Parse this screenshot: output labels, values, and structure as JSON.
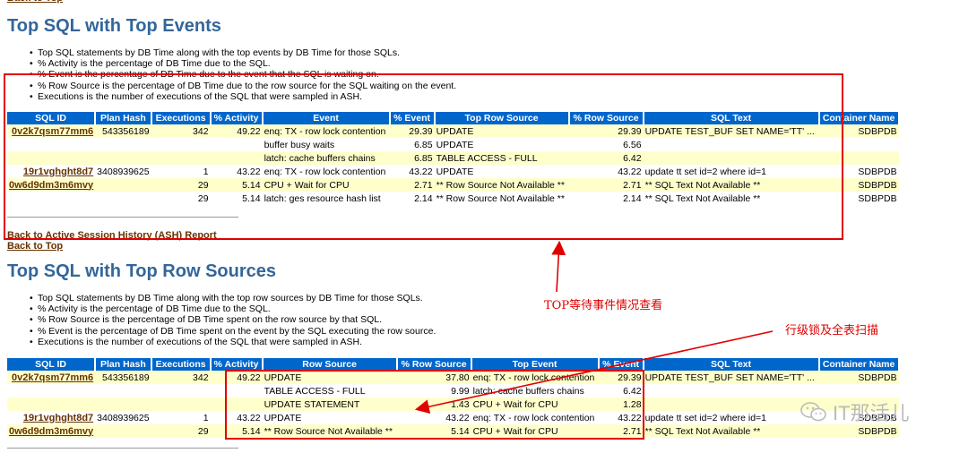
{
  "nav": {
    "back_to_top": "Back to Top",
    "back_to_ash": "Back to Active Session History (ASH) Report"
  },
  "section1": {
    "title": "Top SQL with Top Events",
    "notes": [
      "Top SQL statements by DB Time along with the top events by DB Time for those SQLs.",
      "% Activity is the percentage of DB Time due to the SQL.",
      "% Event is the percentage of DB Time due to the event that the SQL is waiting on.",
      "% Row Source is the percentage of DB Time due to the row source for the SQL waiting on the event.",
      "Executions is the number of executions of the SQL that were sampled in ASH."
    ],
    "headers": [
      "SQL ID",
      "Plan Hash",
      "Executions",
      "% Activity",
      "Event",
      "% Event",
      "Top Row Source",
      "% Row Source",
      "SQL Text",
      "Container Name"
    ],
    "rows": [
      [
        "0v2k7qsm77mm6",
        "543356189",
        "342",
        "49.22",
        "enq: TX - row lock contention",
        "29.39",
        "UPDATE",
        "29.39",
        "UPDATE TEST_BUF SET NAME='TT' ...",
        "SDBPDB"
      ],
      [
        "",
        "",
        "",
        "",
        "buffer busy waits",
        "6.85",
        "UPDATE",
        "6.56",
        "",
        ""
      ],
      [
        "",
        "",
        "",
        "",
        "latch: cache buffers chains",
        "6.85",
        "TABLE ACCESS - FULL",
        "6.42",
        "",
        ""
      ],
      [
        "19r1vghght8d7",
        "3408939625",
        "1",
        "43.22",
        "enq: TX - row lock contention",
        "43.22",
        "UPDATE",
        "43.22",
        "update tt set id=2 where id=1",
        "SDBPDB"
      ],
      [
        "0w6d9dm3m6mvy",
        "",
        "29",
        "5.14",
        "CPU + Wait for CPU",
        "2.71",
        "** Row Source Not Available **",
        "2.71",
        "** SQL Text Not Available **",
        "SDBPDB"
      ],
      [
        "",
        "",
        "29",
        "5.14",
        "latch: ges resource hash list",
        "2.14",
        "** Row Source Not Available **",
        "2.14",
        "** SQL Text Not Available **",
        "SDBPDB"
      ]
    ]
  },
  "section2": {
    "title": "Top SQL with Top Row Sources",
    "notes": [
      "Top SQL statements by DB Time along with the top row sources by DB Time for those SQLs.",
      "% Activity is the percentage of DB Time due to the SQL.",
      "% Row Source is the percentage of DB Time spent on the row source by that SQL.",
      "% Event is the percentage of DB Time spent on the event by the SQL executing the row source.",
      "Executions is the number of executions of the SQL that were sampled in ASH."
    ],
    "headers": [
      "SQL ID",
      "Plan Hash",
      "Executions",
      "% Activity",
      "Row Source",
      "% Row Source",
      "Top Event",
      "% Event",
      "SQL Text",
      "Container Name"
    ],
    "rows": [
      [
        "0v2k7qsm77mm6",
        "543356189",
        "342",
        "49.22",
        "UPDATE",
        "37.80",
        "enq: TX - row lock contention",
        "29.39",
        "UPDATE TEST_BUF SET NAME='TT' ...",
        "SDBPDB"
      ],
      [
        "",
        "",
        "",
        "",
        "TABLE ACCESS - FULL",
        "9.99",
        "latch: cache buffers chains",
        "6.42",
        "",
        ""
      ],
      [
        "",
        "",
        "",
        "",
        "UPDATE STATEMENT",
        "1.43",
        "CPU + Wait for CPU",
        "1.28",
        "",
        ""
      ],
      [
        "19r1vghght8d7",
        "3408939625",
        "1",
        "43.22",
        "UPDATE",
        "43.22",
        "enq: TX - row lock contention",
        "43.22",
        "update tt set id=2 where id=1",
        "SDBPDB"
      ],
      [
        "0w6d9dm3m6mvy",
        "",
        "29",
        "5.14",
        "** Row Source Not Available **",
        "5.14",
        "CPU + Wait for CPU",
        "2.71",
        "** SQL Text Not Available **",
        "SDBPDB"
      ]
    ]
  },
  "annotations": {
    "top_events": "TOP等待事件情况查看",
    "row_lock": "行级锁及全表扫描"
  },
  "watermark": {
    "text": "IT那活儿"
  },
  "colors": {
    "header_bg": "#0066cc",
    "title": "#336699",
    "odd_row": "#ffffcc",
    "link": "#663300",
    "annotation": "#e00000"
  }
}
